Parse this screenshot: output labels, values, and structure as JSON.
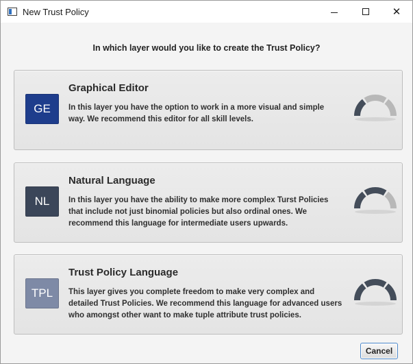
{
  "window": {
    "title": "New Trust Policy",
    "controls": {
      "minimize": "minimize",
      "maximize": "maximize",
      "close": "✕"
    }
  },
  "question": "In which layer would you like to create the Trust Policy?",
  "options": [
    {
      "badge": "GE",
      "title": "Graphical Editor",
      "description": "In this layer you have the option to work in a more visual and simple way. We recommend this editor for all skill levels.",
      "badge_color": "#1e3d8c",
      "difficulty_level": 1,
      "difficulty_max": 3
    },
    {
      "badge": "NL",
      "title": "Natural Language",
      "description": "In this layer you have the ability to make more complex Turst Policies that include not just binomial policies but also ordinal ones. We recommend this language for intermediate users upwards.",
      "badge_color": "#3b4659",
      "difficulty_level": 2,
      "difficulty_max": 3
    },
    {
      "badge": "TPL",
      "title": "Trust Policy Language",
      "description": "This layer gives you complete freedom to make very complex and detailed Trust Policies. We recommend this language for advanced users who amongst other want to make tuple attribute trust policies.",
      "badge_color": "#7e8aa6",
      "difficulty_level": 3,
      "difficulty_max": 3
    }
  ],
  "gauge_colors": {
    "active": "#444d5a",
    "inactive": "#b8b8b8"
  },
  "buttons": {
    "cancel": "Cancel"
  }
}
